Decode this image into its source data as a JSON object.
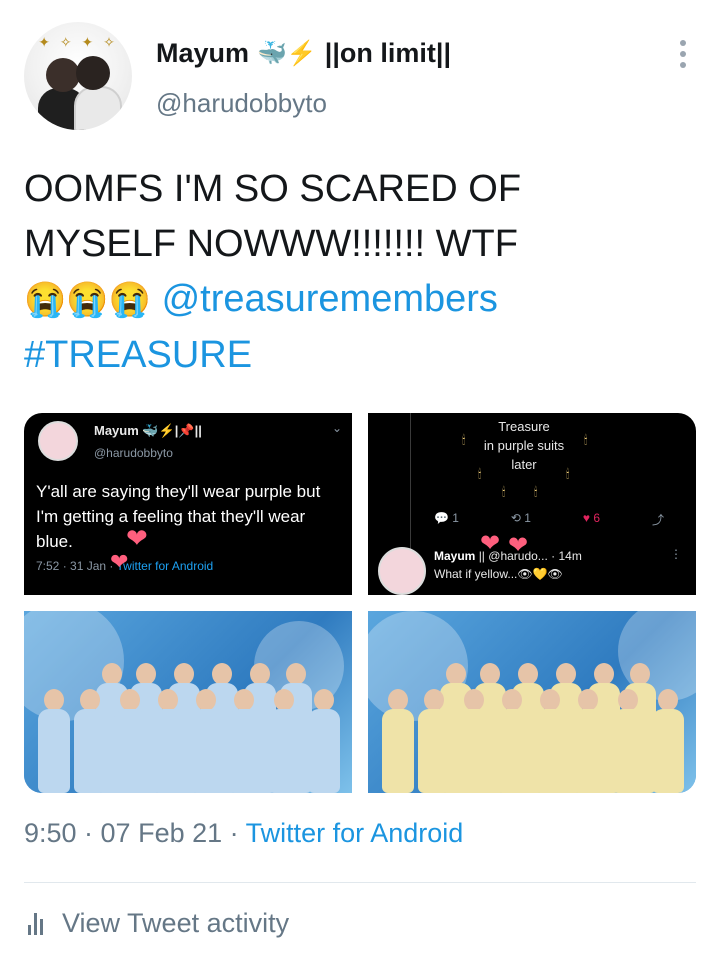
{
  "author": {
    "display_name": "Mayum",
    "name_emoji": "🐳⚡",
    "name_suffix": "||on limit||",
    "handle": "@harudobbyto"
  },
  "tweet": {
    "line1": "OOMFS I'M SO SCARED OF",
    "line2": "MYSELF NOWWW!!!!!!! WTF",
    "emojis": "😭😭😭",
    "mention": "@treasuremembers",
    "hashtag": "#TREASURE"
  },
  "media": {
    "embedded_tweet_1": {
      "name": "Mayum 🐳⚡|📌||",
      "handle": "@harudobbyto",
      "text": "Y'all are saying they'll wear purple but I'm getting a feeling that they'll wear blue.",
      "time": "7:52 · 31 Jan · ",
      "source": "Twitter for Android"
    },
    "embedded_tweet_2": {
      "caption_line1": "Treasure",
      "caption_line2": "in purple suits",
      "caption_line3": "later",
      "replies": "1",
      "retweets": "1",
      "likes": "6",
      "reply_name": "Mayum",
      "reply_meta": "|| @harudo... · 14m",
      "reply_text": "What if yellow...👁💛👁"
    }
  },
  "footer": {
    "time_date": "9:50 · 07 Feb 21 · ",
    "source": "Twitter for Android",
    "activity_label": "View Tweet activity"
  },
  "colors": {
    "link_blue": "#1b95e0",
    "secondary_text": "#657786",
    "primary_text": "#14171a",
    "like_red": "#e0245e",
    "blue_suits": "#bcd7ef",
    "yellow_suits": "#efe3a8"
  }
}
